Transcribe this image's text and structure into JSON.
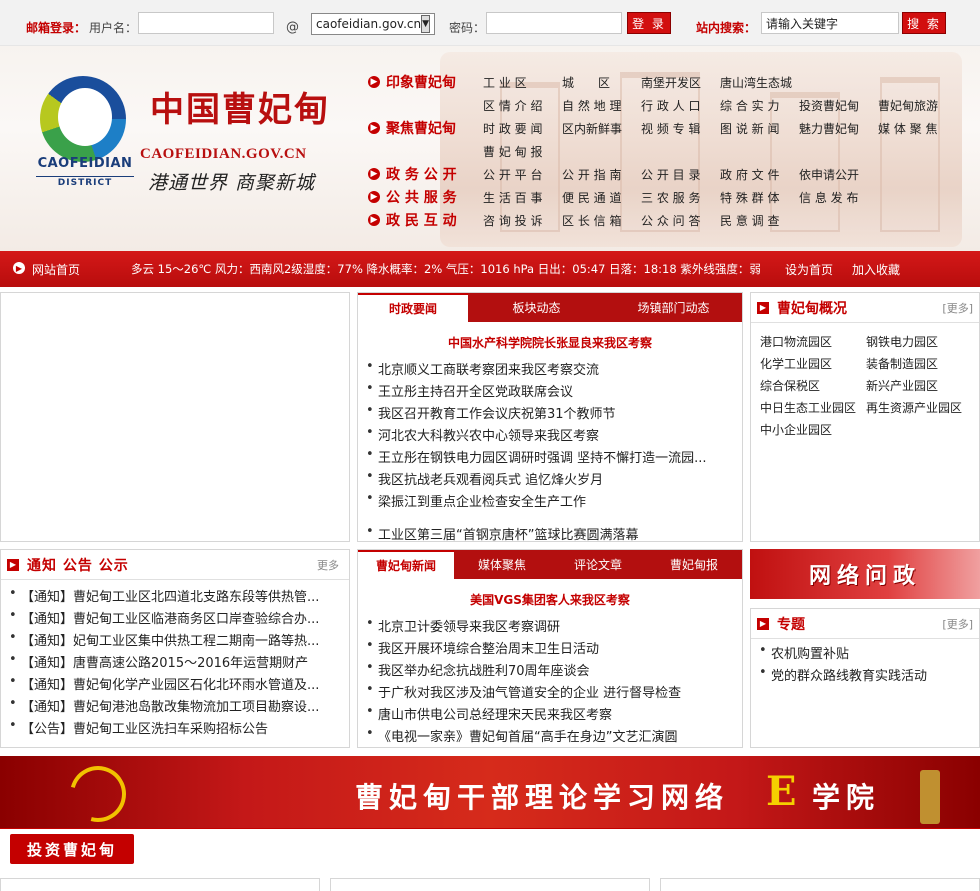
{
  "topbar": {
    "mail_label": "邮箱登录：",
    "user_label": "用户名：",
    "user_value": "",
    "at": "@",
    "domain_selected": "caofeidian.gov.cn",
    "pwd_label": "密码：",
    "login_btn": "登 录",
    "search_label": "站内搜索：",
    "search_placeholder": "请输入关键字",
    "search_btn": "搜 索"
  },
  "brand": {
    "logo_text": "CAOFEIDIAN",
    "logo_sub": "DISTRICT",
    "name_cn": "中国曹妃甸",
    "url": "CAOFEIDIAN.GOV.CN",
    "slogan": "港通世界 商聚新城"
  },
  "nav": {
    "rows": [
      {
        "cat": "印象曹妃甸",
        "links": [
          "工 业 区",
          "城　　区",
          "南堡开发区",
          "唐山湾生态城"
        ]
      },
      {
        "cat": "",
        "links": [
          "区 情 介 绍",
          "自 然 地 理",
          "行 政 人 口",
          "综 合 实 力",
          "投资曹妃甸",
          "曹妃甸旅游"
        ]
      },
      {
        "cat": "聚焦曹妃甸",
        "links": [
          "时 政 要 闻",
          "区内新鲜事",
          "视 频 专 辑",
          "图 说 新 闻",
          "魅力曹妃甸",
          "媒 体 聚 焦"
        ]
      },
      {
        "cat": "",
        "links": [
          "曹 妃 甸 报"
        ]
      },
      {
        "cat": "政 务 公 开",
        "links": [
          "公 开 平 台",
          "公 开 指 南",
          "公 开 目 录",
          "政 府 文 件",
          "依申请公开"
        ]
      },
      {
        "cat": "公 共 服 务",
        "links": [
          "生 活 百 事",
          "便 民 通 道",
          "三 农 服 务",
          "特 殊 群 体",
          "信 息 发 布"
        ]
      },
      {
        "cat": "政 民 互 动",
        "links": [
          "咨 询 投 诉",
          "区 长 信 箱",
          "公 众 问 答",
          "民 意 调 查"
        ]
      }
    ]
  },
  "ticker": {
    "home": "网站首页",
    "weather": "多云 15～26℃ 风力：西南风2级湿度：77% 降水概率：2% 气压：1016 hPa 日出：05:47 日落：18:18 紫外线强度：弱",
    "set_home": "设为首页",
    "favorite": "加入收藏"
  },
  "news1": {
    "tabs": [
      "时政要闻",
      "板块动态",
      "场镇部门动态"
    ],
    "headline": "中国水产科学院院长张显良来我区考察",
    "items": [
      "北京顺义工商联考察团来我区考察交流",
      "王立彤主持召开全区党政联席会议",
      "我区召开教育工作会议庆祝第31个教师节",
      "河北农大科教兴农中心领导来我区考察",
      "王立彤在钢铁电力园区调研时强调 坚持不懈打造一流园...",
      "我区抗战老兵观看阅兵式 追忆烽火岁月",
      "梁振江到重点企业检查安全生产工作"
    ],
    "extra": "工业区第三届“首钢京唐杯”篮球比赛圆满落幕"
  },
  "overview": {
    "title": "曹妃甸概况",
    "more": "[更多]",
    "links": [
      "港口物流园区",
      "钢铁电力园区",
      "化学工业园区",
      "装备制造园区",
      "综合保税区",
      "新兴产业园区",
      "中日生态工业园区",
      "再生资源产业园区",
      "中小企业园区"
    ]
  },
  "notice": {
    "title": "通知 公告 公示",
    "more": "更多",
    "items": [
      "【通知】曹妃甸工业区北四道北支路东段等供热管...",
      "【通知】曹妃甸工业区临港商务区口岸查验综合办...",
      "【通知】妃甸工业区集中供热工程二期南一路等热...",
      "【通知】唐曹高速公路2015～2016年运营期财产",
      "【通知】曹妃甸化学产业园区石化北环雨水管道及...",
      "【通知】曹妃甸港池岛散改集物流加工项目勘察设...",
      "【公告】曹妃甸工业区洗扫车采购招标公告"
    ]
  },
  "news2": {
    "tabs": [
      "曹妃甸新闻",
      "媒体聚焦",
      "评论文章",
      "曹妃甸报"
    ],
    "headline": "美国VGS集团客人来我区考察",
    "items": [
      "北京卫计委领导来我区考察调研",
      "我区开展环境综合整治周末卫生日活动",
      "我区举办纪念抗战胜利70周年座谈会",
      "于广秋对我区涉及油气管道安全的企业 进行督导检查",
      "唐山市供电公司总经理宋天民来我区考察",
      "《电视一家亲》曹妃甸首届“高手在身边”文艺汇演圆"
    ]
  },
  "wlwz": {
    "text": "网络问政"
  },
  "special": {
    "title": "专题",
    "more": "[更多]",
    "items": [
      "农机购置补贴",
      "党的群众路线教育实践活动"
    ]
  },
  "elearn": {
    "text": "曹妃甸干部理论学习网络",
    "e": "E",
    "tail": "学院"
  },
  "invest": {
    "title": "投资曹妃甸"
  },
  "colors": {
    "brand_red": "#c40000",
    "ticker_red": "#c81212",
    "logo_blue": "#1a3d7a"
  }
}
